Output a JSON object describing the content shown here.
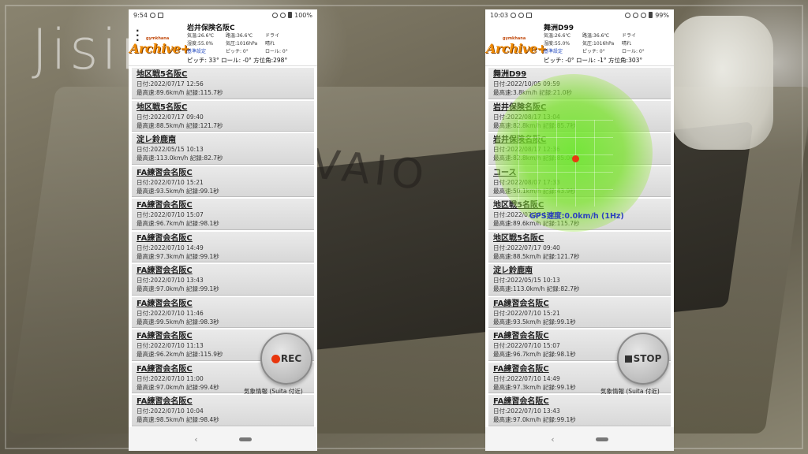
{
  "watermark": "Jisin.com",
  "bg_brand": "VAIO",
  "left": {
    "status": {
      "time": "9:54",
      "battery": "100%"
    },
    "header": {
      "logo_small": "gymkhana",
      "logo_main": "Archive+",
      "course": "岩井保険名阪C",
      "env": [
        "気温:26.6℃",
        "路温:36.6℃",
        "ドライ",
        "湿度:55.0%",
        "気圧:1016hPa",
        "晴れ",
        "基準設定",
        "ピッチ: 0°",
        "ロール: 0°"
      ],
      "pitch_line": "ピッチ:  33°  ロール:  -0°  方位角:298°"
    },
    "records": [
      {
        "title": "地区戦5名阪C",
        "date": "日付:2022/07/17 12:56",
        "stats": "最高速:89.6km/h 記録:115.7秒"
      },
      {
        "title": "地区戦5名阪C",
        "date": "日付:2022/07/17 09:40",
        "stats": "最高速:88.5km/h 記録:121.7秒"
      },
      {
        "title": "淀レ鈴鹿南",
        "date": "日付:2022/05/15 10:13",
        "stats": "最高速:113.0km/h 記録:82.7秒"
      },
      {
        "title": "FA練習会名阪C",
        "date": "日付:2022/07/10 15:21",
        "stats": "最高速:93.5km/h 記録:99.1秒"
      },
      {
        "title": "FA練習会名阪C",
        "date": "日付:2022/07/10 15:07",
        "stats": "最高速:96.7km/h 記録:98.1秒"
      },
      {
        "title": "FA練習会名阪C",
        "date": "日付:2022/07/10 14:49",
        "stats": "最高速:97.3km/h 記録:99.1秒"
      },
      {
        "title": "FA練習会名阪C",
        "date": "日付:2022/07/10 13:43",
        "stats": "最高速:97.0km/h 記録:99.1秒"
      },
      {
        "title": "FA練習会名阪C",
        "date": "日付:2022/07/10 11:46",
        "stats": "最高速:99.5km/h 記録:98.3秒"
      },
      {
        "title": "FA練習会名阪C",
        "date": "日付:2022/07/10 11:13",
        "stats": "最高速:96.2km/h 記録:115.9秒"
      },
      {
        "title": "FA練習会名阪C",
        "date": "日付:2022/07/10 11:00",
        "stats": "最高速:97.0km/h 記録:99.4秒"
      },
      {
        "title": "FA練習会名阪C",
        "date": "日付:2022/07/10 10:04",
        "stats": "最高速:98.5km/h 記録:98.4秒"
      }
    ],
    "action_button": "REC",
    "weather_label": "気象情報 (Suita 付近)"
  },
  "right": {
    "status": {
      "time": "10:03",
      "battery": "99%"
    },
    "header": {
      "logo_small": "gymkhana",
      "logo_main": "Archive+",
      "course": "舞洲D99",
      "env": [
        "気温:26.6℃",
        "路温:36.6℃",
        "ドライ",
        "湿度:55.0%",
        "気圧:1016hPa",
        "晴れ",
        "基準設定",
        "ピッチ: 0°",
        "ロール: 0°"
      ],
      "pitch_line": "ピッチ:  -0°  ロール:  -1°  方位角:303°"
    },
    "records": [
      {
        "title": "舞洲D99",
        "date": "日付:2022/10/05 09:59",
        "stats": "最高速:3.8km/h 記録:21.0秒"
      },
      {
        "title": "岩井保険名阪C",
        "date": "日付:2022/08/17 13:04",
        "stats": "最高速:82.8km/h 記録:85.7秒"
      },
      {
        "title": "岩井保険名阪C",
        "date": "日付:2022/08/17 12:36",
        "stats": "最高速:82.8km/h 記録:85.0秒"
      },
      {
        "title": "コース",
        "date": "日付:2022/08/07 17:33",
        "stats": "最高速:50.1km/h 記録:43.9秒"
      },
      {
        "title": "地区戦5名阪C",
        "date": "日付:2022/07/17 12:56",
        "stats": "最高速:89.6km/h 記録:115.7秒"
      },
      {
        "title": "地区戦5名阪C",
        "date": "日付:2022/07/17 09:40",
        "stats": "最高速:88.5km/h 記録:121.7秒"
      },
      {
        "title": "淀レ鈴鹿南",
        "date": "日付:2022/05/15 10:13",
        "stats": "最高速:113.0km/h 記録:82.7秒"
      },
      {
        "title": "FA練習会名阪C",
        "date": "日付:2022/07/10 15:21",
        "stats": "最高速:93.5km/h 記録:99.1秒"
      },
      {
        "title": "FA練習会名阪C",
        "date": "日付:2022/07/10 15:07",
        "stats": "最高速:96.7km/h 記録:98.1秒"
      },
      {
        "title": "FA練習会名阪C",
        "date": "日付:2022/07/10 14:49",
        "stats": "最高速:97.3km/h 記録:99.1秒"
      },
      {
        "title": "FA練習会名阪C",
        "date": "日付:2022/07/10 13:43",
        "stats": "最高速:97.0km/h 記録:99.1秒"
      }
    ],
    "action_button": "STOP",
    "weather_label": "気象情報 (Suita 付近)",
    "gps_speed": "GPS速度:0.0km/h (1Hz)"
  },
  "colors": {
    "logo": "#f08a00",
    "rec_dot": "#e8360d",
    "gps_glow": "#69e628",
    "gps_text": "#2a3fbf",
    "link": "#2a4fc0"
  },
  "icons": [
    "menu-icon",
    "wifi-icon",
    "battery-icon",
    "back-icon",
    "home-icon"
  ]
}
